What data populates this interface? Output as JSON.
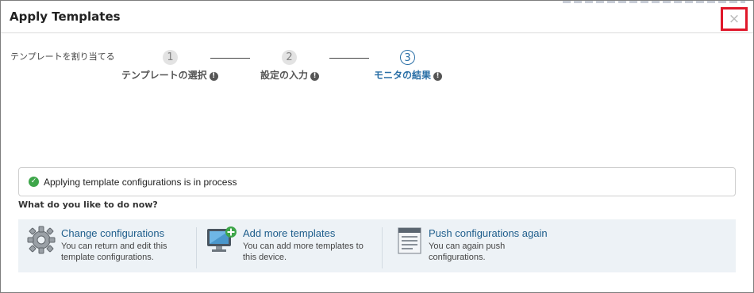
{
  "dialog": {
    "title": "Apply Templates",
    "close_glyph": "×"
  },
  "wizard": {
    "assign_label": "テンプレートを割り当てる",
    "steps": [
      {
        "number": "1",
        "label": "テンプレートの選択",
        "state": "done"
      },
      {
        "number": "2",
        "label": "設定の入力",
        "state": "done"
      },
      {
        "number": "3",
        "label": "モニタの結果",
        "state": "active"
      }
    ],
    "info_glyph": "!"
  },
  "status": {
    "icon": "check-circle-icon",
    "text": "Applying template configurations is in process",
    "color": "#3ea64a"
  },
  "next": {
    "question": "What do you like to do now?",
    "actions": [
      {
        "icon": "gear-cog-icon",
        "title": "Change configurations",
        "desc": "You can return and edit this template configurations."
      },
      {
        "icon": "monitor-add-icon",
        "title": "Add more templates",
        "desc": "You can add more templates to this device."
      },
      {
        "icon": "document-push-icon",
        "title": "Push configurations again",
        "desc": "You can again push configurations."
      }
    ]
  },
  "colors": {
    "accent": "#2a6fa6",
    "close_highlight": "#e0172a",
    "link": "#1f5e8c",
    "panel_bg": "#edf2f6"
  }
}
